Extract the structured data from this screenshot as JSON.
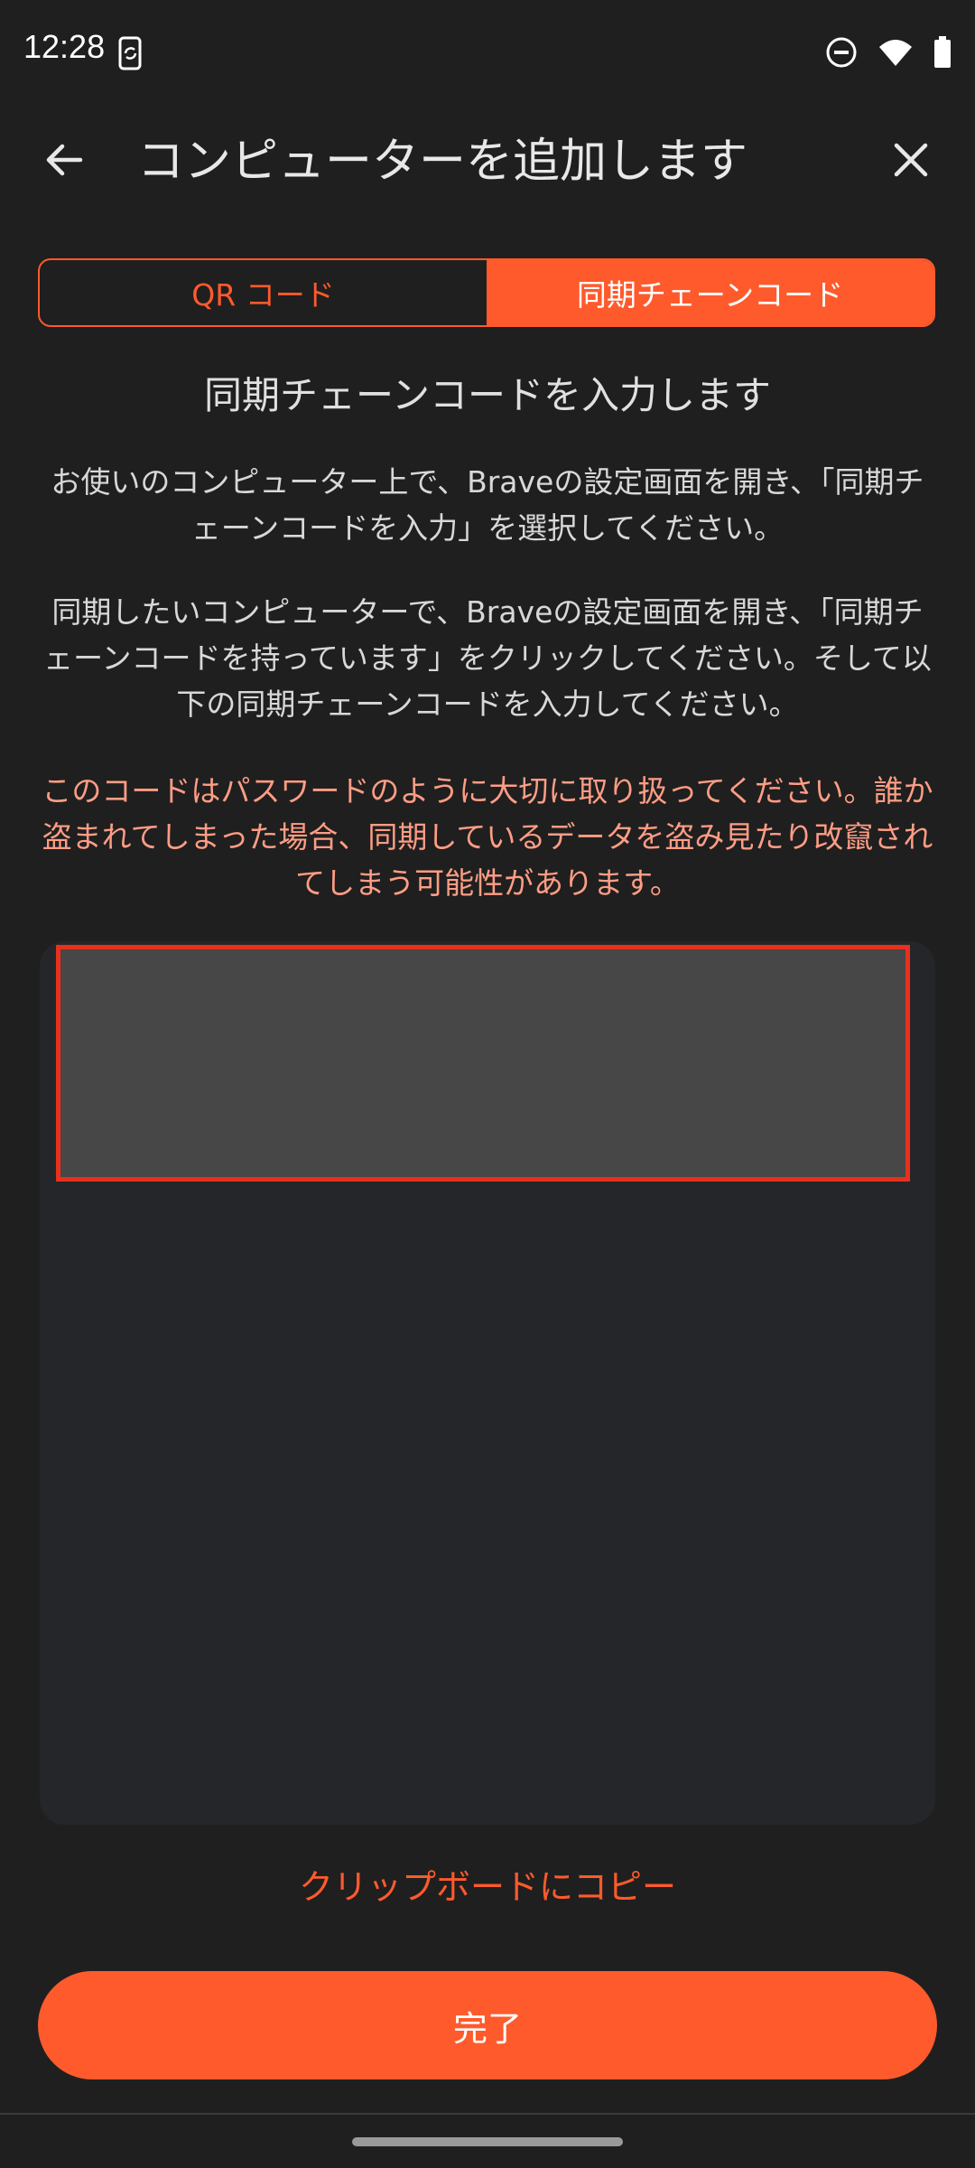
{
  "status_bar": {
    "time": "12:28",
    "icons": [
      "phone-sync-icon",
      "do-not-disturb-icon",
      "wifi-icon",
      "battery-icon"
    ]
  },
  "app_bar": {
    "title": "コンピューターを追加します",
    "back_icon": "arrow-back-icon",
    "close_icon": "close-icon"
  },
  "tabs": [
    {
      "label": "QR コード",
      "selected": false
    },
    {
      "label": "同期チェーンコード",
      "selected": true
    }
  ],
  "section_title": "同期チェーンコードを入力します",
  "paragraphs": [
    "お使いのコンピューター上で、Braveの設定画面を開き、「同期チェーンコードを入力」を選択してください。",
    "同期したいコンピューターで、Braveの設定画面を開き、「同期チェーンコードを持っています」をクリックしてください。そして以下の同期チェーンコードを入力してください。"
  ],
  "warning": "このコードはパスワードのように大切に取り扱ってください。誰か盗まれてしまった場合、同期しているデータを盗み見たり改竄されてしまう可能性があります。",
  "code_field": {
    "value": ""
  },
  "copy_link": "クリップボードにコピー",
  "done_button": "完了",
  "colors": {
    "background": "#1f1f1f",
    "accent": "#ff5a2c",
    "warning_text": "#ff9d85",
    "panel": "#24262a",
    "field": "#474747",
    "field_border": "#e8301c"
  }
}
